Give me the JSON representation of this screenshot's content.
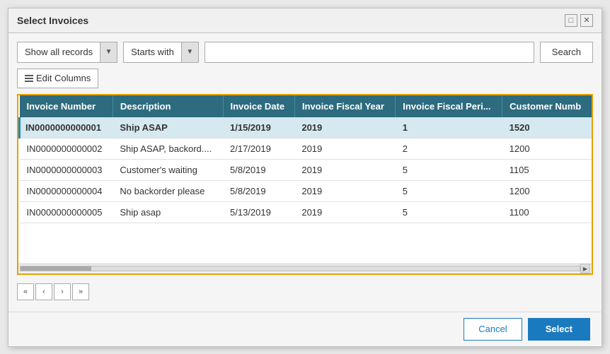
{
  "dialog": {
    "title": "Select Invoices"
  },
  "titlebar": {
    "maximize_label": "□",
    "close_label": "✕"
  },
  "toolbar": {
    "show_filter_label": "Show all records",
    "starts_with_label": "Starts with",
    "search_placeholder": "",
    "search_button_label": "Search",
    "edit_columns_label": "Edit Columns"
  },
  "table": {
    "columns": [
      "Invoice Number",
      "Description",
      "Invoice Date",
      "Invoice Fiscal Year",
      "Invoice Fiscal Peri...",
      "Customer Numb"
    ],
    "rows": [
      {
        "invoice_number": "IN0000000000001",
        "description": "Ship ASAP",
        "invoice_date": "1/15/2019",
        "fiscal_year": "2019",
        "fiscal_period": "1",
        "customer_number": "1520",
        "selected": true
      },
      {
        "invoice_number": "IN0000000000002",
        "description": "Ship ASAP, backord....",
        "invoice_date": "2/17/2019",
        "fiscal_year": "2019",
        "fiscal_period": "2",
        "customer_number": "1200",
        "selected": false
      },
      {
        "invoice_number": "IN0000000000003",
        "description": "Customer's waiting",
        "invoice_date": "5/8/2019",
        "fiscal_year": "2019",
        "fiscal_period": "5",
        "customer_number": "1105",
        "selected": false
      },
      {
        "invoice_number": "IN0000000000004",
        "description": "No backorder please",
        "invoice_date": "5/8/2019",
        "fiscal_year": "2019",
        "fiscal_period": "5",
        "customer_number": "1200",
        "selected": false
      },
      {
        "invoice_number": "IN0000000000005",
        "description": "Ship asap",
        "invoice_date": "5/13/2019",
        "fiscal_year": "2019",
        "fiscal_period": "5",
        "customer_number": "1100",
        "selected": false
      }
    ]
  },
  "pagination": {
    "first_label": "«",
    "prev_label": "‹",
    "next_label": "›",
    "last_label": "»"
  },
  "footer": {
    "cancel_label": "Cancel",
    "select_label": "Select"
  }
}
